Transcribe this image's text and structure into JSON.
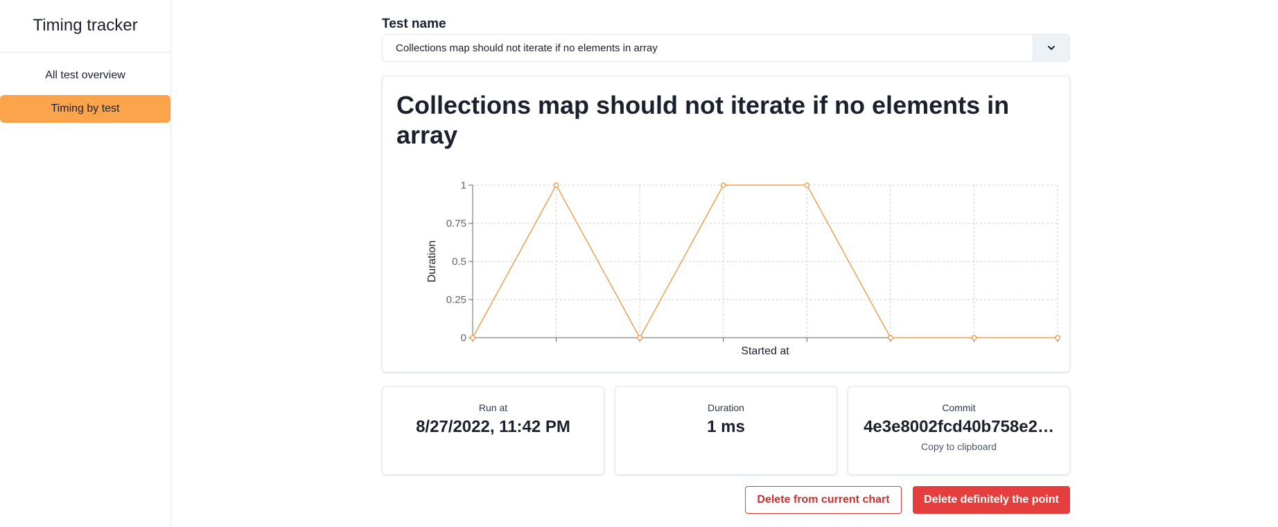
{
  "sidebar": {
    "title": "Timing tracker",
    "items": [
      {
        "label": "All test overview",
        "active": false
      },
      {
        "label": "Timing by test",
        "active": true
      }
    ],
    "accent_color": "#fba44b"
  },
  "test_select": {
    "label": "Test name",
    "value": "Collections map should not iterate if no elements in array"
  },
  "chart_card": {
    "title": "Collections map should not iterate if no elements in array"
  },
  "chart_data": {
    "type": "line",
    "xlabel": "Started at",
    "ylabel": "Duration",
    "ylim": [
      0,
      1
    ],
    "yticks": [
      "0",
      "0.25",
      "0.5",
      "0.75",
      "1"
    ],
    "x": [
      0,
      1,
      2,
      3,
      4,
      5,
      6,
      7
    ],
    "values": [
      0,
      1,
      0,
      1,
      1,
      0,
      0,
      0
    ],
    "grid": true,
    "line_color": "#f6892a"
  },
  "stats": {
    "run_at": {
      "label": "Run at",
      "value": "8/27/2022, 11:42 PM"
    },
    "duration": {
      "label": "Duration",
      "value": "1 ms"
    },
    "commit": {
      "label": "Commit",
      "value": "4e3e8002fcd40b758e2…",
      "help": "Copy to clipboard"
    }
  },
  "actions": {
    "delete_chart": "Delete from current chart",
    "delete_point": "Delete definitely the point"
  },
  "colors": {
    "danger": "#e53e3e"
  }
}
